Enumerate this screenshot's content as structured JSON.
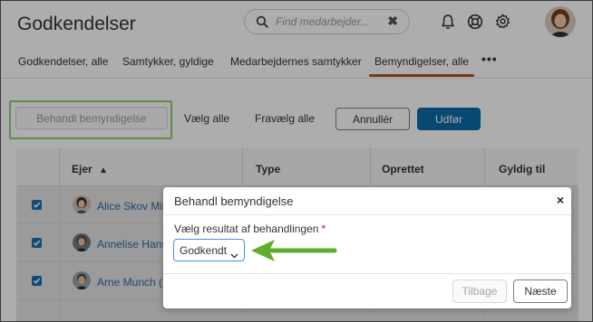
{
  "app": {
    "title": "Godkendelser"
  },
  "search": {
    "placeholder": "Find medarbejder...",
    "clear_label": "✖"
  },
  "tabs": [
    {
      "label": "Godkendelser, alle"
    },
    {
      "label": "Samtykker, gyldige"
    },
    {
      "label": "Medarbejdernes samtykker"
    },
    {
      "label": "Bemyndigelser, alle",
      "active": true
    }
  ],
  "tab_more_label": "•••",
  "toolbar": {
    "process_label": "Behandl bemyndigelse",
    "select_all_label": "Vælg alle",
    "deselect_all_label": "Fravælg alle",
    "cancel_label": "Annullér",
    "execute_label": "Udfør"
  },
  "table": {
    "headers": {
      "owner": "Ejer",
      "type": "Type",
      "created": "Oprettet",
      "valid_until": "Gyldig til"
    },
    "sort_indicator": "▲",
    "rows": [
      {
        "name": "Alice Skov Mik",
        "checked": true
      },
      {
        "name": "Annelise Hans",
        "checked": true
      },
      {
        "name": "Arne Munch (F",
        "checked": true
      }
    ]
  },
  "modal": {
    "title": "Behandl bemyndigelse",
    "close_label": "×",
    "field_label": "Vælg resultat af behandlingen",
    "required_mark": "*",
    "selected_value": "Godkendt",
    "back_label": "Tilbage",
    "next_label": "Næste"
  },
  "colors": {
    "accent": "#0e6ba8",
    "tab_active": "#b5541a",
    "highlight": "#8ed06c",
    "arrow": "#5fae2e",
    "link": "#2a6aa8"
  }
}
